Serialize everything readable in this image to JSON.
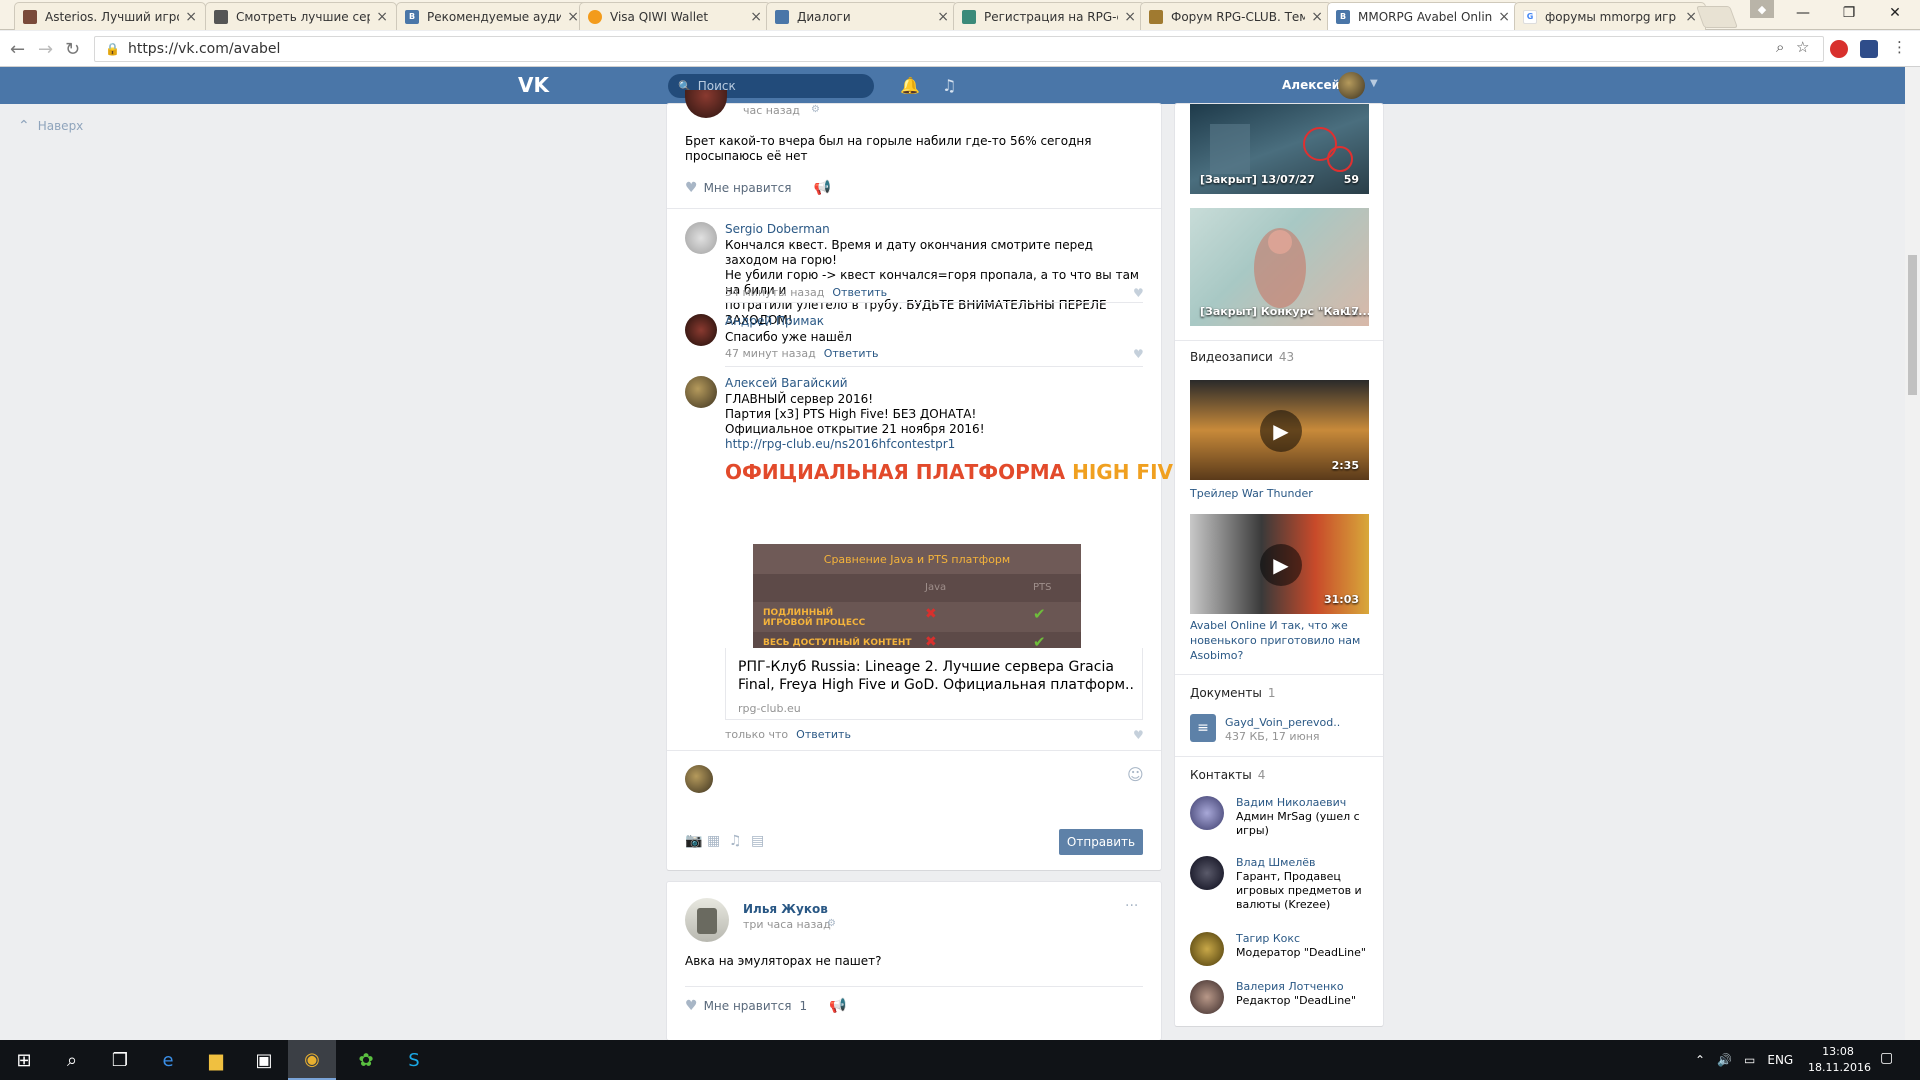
{
  "browser": {
    "tabs": [
      {
        "title": "Asterios. Лучший игрово",
        "color": "#7a4a3a",
        "active": false
      },
      {
        "title": "Смотреть лучшие сериа",
        "color": "#555555",
        "active": false
      },
      {
        "title": "Рекомендуемые аудио",
        "color": "#4a76a8",
        "active": false
      },
      {
        "title": "Visa QIWI Wallet",
        "color": "#f39b1b",
        "active": false
      },
      {
        "title": "Диалоги",
        "color": "#4a76a8",
        "active": false
      },
      {
        "title": "Регистрация на RPG-club",
        "color": "#3b8a7a",
        "active": false
      },
      {
        "title": "Форум RPG-CLUB. Тема",
        "color": "#a07a30",
        "active": false
      },
      {
        "title": "MMORPG Avabel Online",
        "color": "#4a76a8",
        "active": true
      },
      {
        "title": "форумы mmorpg игр а",
        "color": "#4285f4",
        "active": false
      }
    ],
    "url": "https://vk.com/avabel"
  },
  "vk_header": {
    "logo": "VK",
    "search_placeholder": "Поиск",
    "user_name": "Алексей"
  },
  "left": {
    "up_label": "Наверх"
  },
  "post1": {
    "time": "час назад",
    "text": "Брет какой-то вчера был на горыле набили где-то 56% сегодня просыпаюсь её нет",
    "like_label": "Мне нравится",
    "comments": [
      {
        "author": "Sergio Doberman",
        "lines": [
          "Кончался квест. Время и дату окончания смотрите перед заходом на горю!",
          "Не убили горю -> квест кончался=горя пропала, а то что вы там на били и",
          "потратили улетело в трубу. БУДЬТЕ ВНИМАТЕЛЬНЫ ПЕРЕЛЕ ЗАХОДОМ!"
        ],
        "time": "54 минуты назад",
        "reply": "Ответить"
      },
      {
        "author": "Андрей Примак",
        "lines": [
          "Спасибо уже нашёл"
        ],
        "time": "47 минут назад",
        "reply": "Ответить"
      },
      {
        "author": "Алексей Вагайский",
        "lines": [
          "ГЛАВНЫЙ сервер 2016!",
          "Партия [x3] PTS High Five! БЕЗ ДОНАТА!",
          "Официальное открытие 21 ноября 2016!"
        ],
        "link": "http://rpg-club.eu/ns2016hfcontestpr1",
        "time": "только что",
        "reply": "Ответить"
      }
    ],
    "banner": {
      "main": "ОФИЦИАЛЬНАЯ ПЛАТФОРМА",
      "accent": "HIGH FIVE"
    },
    "table_image": {
      "title": "Сравнение Java и PTS платформ",
      "col1": "Java",
      "col2": "PTS",
      "row1": [
        "ПОДЛИННЫЙ",
        "ИГРОВОЙ ПРОЦЕСС"
      ],
      "row2": "ВЕСЬ ДОСТУПНЫЙ КОНТЕНТ"
    },
    "link_card": {
      "title": "РПГ-Клуб Russia: Lineage 2. Лучшие сервера Gracia Final, Freya High Five и GoD. Официальная платформ..",
      "domain": "rpg-club.eu"
    },
    "send_label": "Отправить"
  },
  "post2": {
    "author": "Илья Жуков",
    "time": "три часа назад",
    "text": "Авка на эмуляторах не пашет?",
    "like_label": "Мне нравится",
    "like_count": "1"
  },
  "right": {
    "albums": [
      {
        "caption": "[Закрыт] 13/07/27",
        "count": "59"
      },
      {
        "caption": "[Закрыт] Конкурс \"Как я...",
        "count": "17"
      }
    ],
    "videos_label": "Видеозаписи",
    "videos_count": "43",
    "videos": [
      {
        "title": "Трейлер War Thunder",
        "duration": "2:35"
      },
      {
        "title": "Avabel Online И так, что же новенького приготовило нам Asobimo?",
        "duration": "31:03"
      }
    ],
    "docs_label": "Документы",
    "docs_count": "1",
    "doc": {
      "name": "Gayd_Voin_perevod..",
      "meta": "437 КБ, 17 июня"
    },
    "contacts_label": "Контакты",
    "contacts_count": "4",
    "contacts": [
      {
        "name": "Вадим Николаевич",
        "role": "Админ MrSag (ушел с игры)"
      },
      {
        "name": "Влад Шмелёв",
        "role": "Гарант, Продавец игровых предметов и валюты (Krezee)"
      },
      {
        "name": "Тагир Кокс",
        "role": "Модератор \"DeadLine\""
      },
      {
        "name": "Валерия Лотченко",
        "role": "Редактор \"DeadLine\""
      }
    ]
  },
  "taskbar": {
    "lang": "ENG",
    "time": "13:08",
    "date": "18.11.2016"
  }
}
